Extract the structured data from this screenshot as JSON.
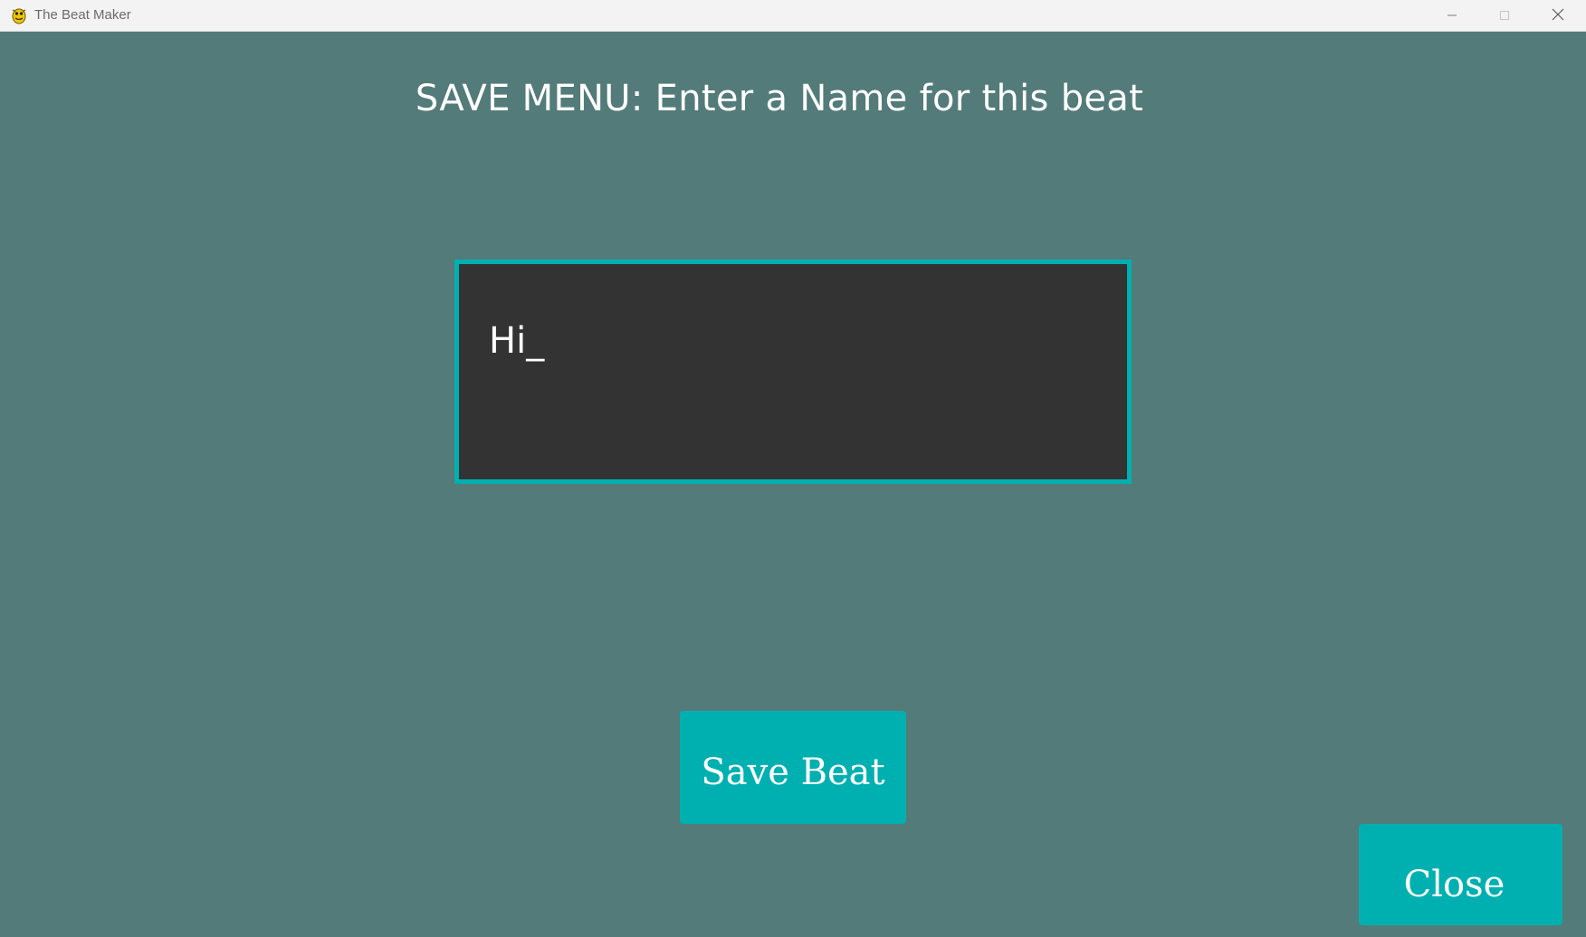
{
  "window": {
    "title": "The Beat Maker",
    "icons": {
      "app": "pygame-snake-icon",
      "minimize": "minimize-icon",
      "maximize": "maximize-icon",
      "close": "close-icon"
    }
  },
  "save_menu": {
    "heading": "SAVE MENU: Enter a Name for this beat",
    "name_value": "Hi_",
    "save_label": "Save Beat",
    "close_label": "Close"
  },
  "colors": {
    "background": "#537b79",
    "accent": "#00b0b0",
    "input_background": "#333333",
    "text": "#ffffff"
  }
}
